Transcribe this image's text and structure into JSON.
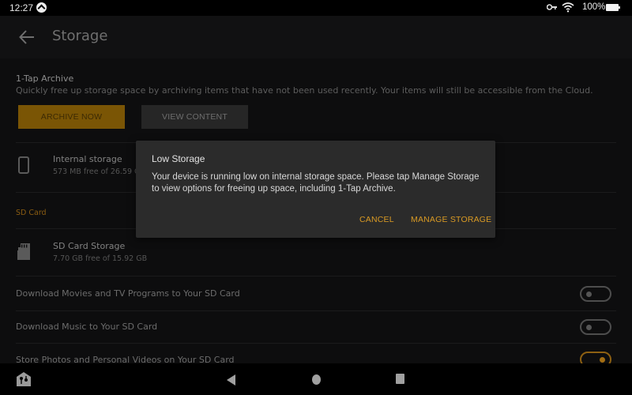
{
  "status_bar": {
    "time": "12:27",
    "notification_icon": "amazon-notification-icon",
    "vpn_icon": "key-icon",
    "wifi_icon": "wifi-icon",
    "battery_percent": "100%",
    "battery_icon": "battery-full-icon"
  },
  "header": {
    "back_icon": "arrow-left-icon",
    "title": "Storage"
  },
  "archive": {
    "title": "1-Tap Archive",
    "description": "Quickly free up storage space by archiving items that have not been used recently. Your items will still be accessible from the Cloud.",
    "archive_now_label": "ARCHIVE NOW",
    "view_content_label": "VIEW CONTENT"
  },
  "internal_storage": {
    "icon": "phone-icon",
    "title": "Internal storage",
    "subtitle": "573 MB free of 26.59 GB"
  },
  "sd_card": {
    "section_label": "SD Card",
    "icon": "sd-card-icon",
    "title": "SD Card Storage",
    "subtitle": "7.70 GB free of 15.92 GB"
  },
  "toggles": [
    {
      "label": "Download Movies and TV Programs to Your SD Card",
      "on": false
    },
    {
      "label": "Download Music to Your SD Card",
      "on": false
    },
    {
      "label": "Store Photos and Personal Videos on Your SD Card",
      "on": true
    }
  ],
  "dialog": {
    "title": "Low Storage",
    "body": "Your device is running low on internal storage space. Please tap Manage Storage to view options for freeing up space, including 1-Tap Archive.",
    "cancel_label": "CANCEL",
    "manage_label": "MANAGE STORAGE"
  },
  "nav_bar": {
    "home_app_icon": "home-house-icon",
    "back_icon": "back-triangle-icon",
    "home_icon": "home-circle-icon",
    "recents_icon": "recents-square-icon"
  },
  "colors": {
    "accent": "#d99a24",
    "archive_button": "#7a5505",
    "dialog_bg": "#2b2b2b",
    "background": "#0d0d0e"
  }
}
